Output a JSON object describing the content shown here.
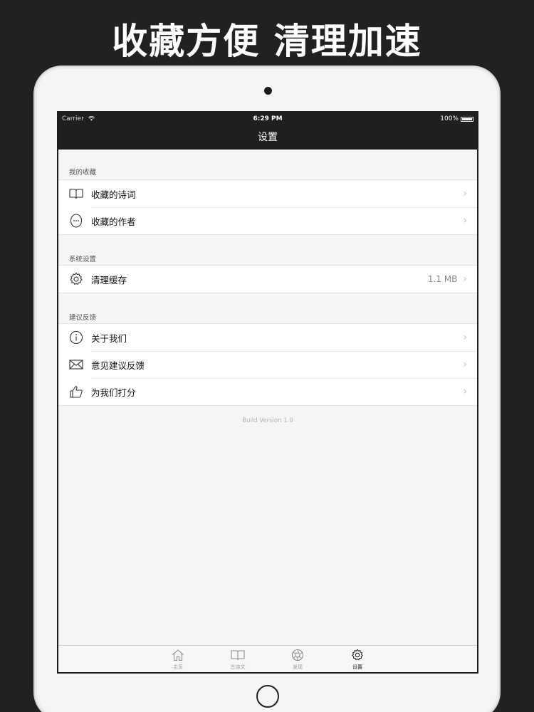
{
  "promo": {
    "title": "收藏方便 清理加速"
  },
  "status": {
    "carrier": "Carrier",
    "time": "6:29 PM",
    "battery": "100%"
  },
  "nav": {
    "title": "设置"
  },
  "sections": [
    {
      "header": "我的收藏",
      "items": [
        {
          "label": "收藏的诗词",
          "icon": "book-icon"
        },
        {
          "label": "收藏的作者",
          "icon": "author-face-icon"
        }
      ]
    },
    {
      "header": "系统设置",
      "items": [
        {
          "label": "清理缓存",
          "icon": "gear-icon",
          "detail": "1.1 MB"
        }
      ]
    },
    {
      "header": "建议反馈",
      "items": [
        {
          "label": "关于我们",
          "icon": "info-icon"
        },
        {
          "label": "意见建议反馈",
          "icon": "mail-icon"
        },
        {
          "label": "为我们打分",
          "icon": "thumbs-up-icon"
        }
      ]
    }
  ],
  "build": "Build Version 1.0",
  "tabs": [
    {
      "label": "主页",
      "icon": "home-icon"
    },
    {
      "label": "古诗文",
      "icon": "book-icon"
    },
    {
      "label": "发现",
      "icon": "aperture-icon"
    },
    {
      "label": "设置",
      "icon": "gear-icon",
      "active": true
    }
  ]
}
